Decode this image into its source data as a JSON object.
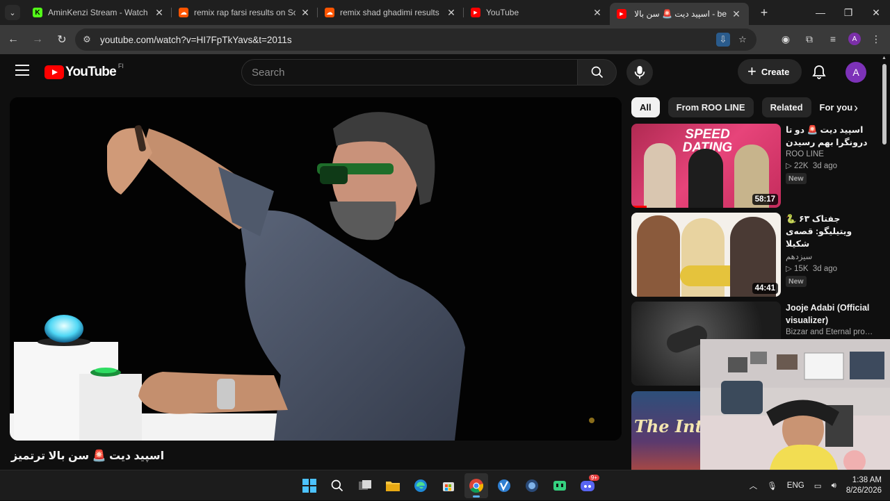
{
  "browser": {
    "tabs": [
      {
        "title": "AminKenzi Stream - Watch Liv",
        "favicon": "kick-icon",
        "color": "#53fc18"
      },
      {
        "title": "remix rap farsi results on Soun",
        "favicon": "soundcloud-icon",
        "color": "#ff5500"
      },
      {
        "title": "remix shad ghadimi results on",
        "favicon": "soundcloud-icon",
        "color": "#ff5500"
      },
      {
        "title": "YouTube",
        "favicon": "youtube-icon",
        "color": "#ff0000"
      },
      {
        "title": "be - اسپید دیت 🚨 سن بالا ترتمیز",
        "favicon": "youtube-icon",
        "color": "#ff0000",
        "active": true
      }
    ],
    "url": "youtube.com/watch?v=HI7FpTkYavs&t=2011s",
    "profile_initial": "A"
  },
  "youtube": {
    "logo_text": "YouTube",
    "country_code": "FI",
    "search_placeholder": "Search",
    "create_label": "Create",
    "avatar_initial": "A",
    "video_title": "اسپید دیت 🚨 سن بالا ترتمیز",
    "chips": [
      "All",
      "From ROO LINE",
      "Related",
      "For you"
    ],
    "recommendations": [
      {
        "title": "اسپید دیت 🚨 دو تا درونگرا بهم رسیدن",
        "channel": "ROO LINE",
        "views": "22K",
        "age": "3d ago",
        "badge": "New",
        "duration": "58:17",
        "rtl": true,
        "thumb_text": "SPEED DATING",
        "progress": 0.1
      },
      {
        "title": "جفتاک ۶۳ 🐍 ویتیلیگو: قصه‌ی شکیلا",
        "channel": "سیزدهم",
        "views": "15K",
        "age": "3d ago",
        "badge": "New",
        "duration": "44:41",
        "rtl": true,
        "thumb_text": "",
        "progress": 0
      },
      {
        "title": "Jooje Adabi (Official visualizer)",
        "channel": "Bizzar and Eternal proje...",
        "views": "",
        "age": "",
        "badge": "",
        "duration": "",
        "rtl": false,
        "thumb_text": "",
        "progress": 0
      },
      {
        "title": "",
        "channel": "",
        "views": "",
        "age": "",
        "badge": "",
        "duration": "",
        "rtl": false,
        "thumb_text": "The Inter",
        "progress": 0
      }
    ]
  },
  "taskbar": {
    "language": "ENG",
    "time": "1:38 AM",
    "date": "8/26/2026",
    "discord_badge": "9+"
  },
  "colors": {
    "youtube_red": "#ff0000",
    "accent_purple": "#7d32b8",
    "page_bg": "#0f0f0f"
  }
}
